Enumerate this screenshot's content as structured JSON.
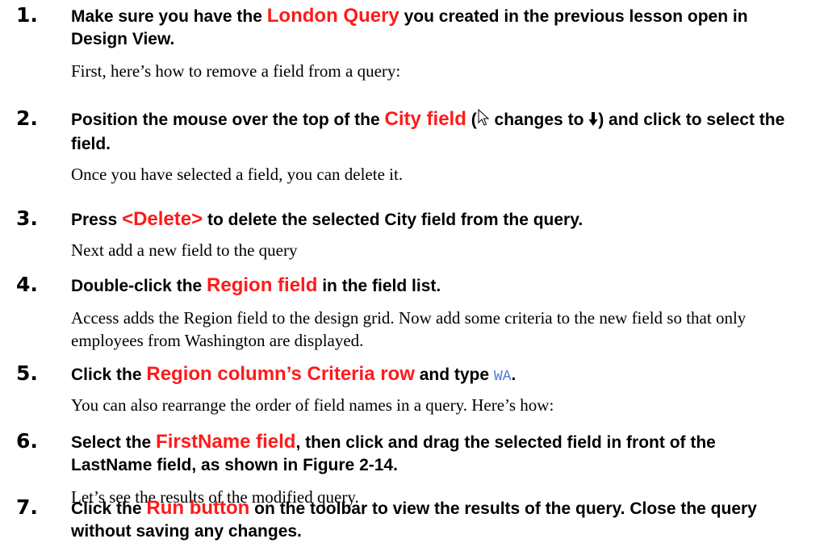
{
  "steps": [
    {
      "number": "1.",
      "parts": [
        "Make sure you have the ",
        "London Query",
        " you created in the previous lesson open in Design View."
      ],
      "note": "First, here’s how to remove a field from a query:"
    },
    {
      "number": "2.",
      "parts": [
        "Position the mouse over the top of the ",
        "City field",
        " (",
        " changes to ",
        ") and click to select the field."
      ],
      "icons": [
        "pointer-arrow-icon",
        "down-arrow-icon"
      ],
      "note": "Once you have selected a field, you can delete it."
    },
    {
      "number": "3.",
      "parts": [
        "Press ",
        "<Delete>",
        " to delete the selected City field from the query."
      ],
      "note": "Next add a new field to the query"
    },
    {
      "number": "4.",
      "parts": [
        "Double-click the ",
        "Region field",
        " in the field list."
      ],
      "note": "Access adds the Region field to the design grid. Now add some criteria to the new field so that only employees from Washington are displayed."
    },
    {
      "number": "5.",
      "parts": [
        "Click the ",
        "Region column’s Criteria row",
        " and type ",
        "WA",
        "."
      ],
      "note": "You can also rearrange the order of field names in a query. Here’s how:"
    },
    {
      "number": "6.",
      "parts": [
        "Select the ",
        "FirstName field",
        ", then click and drag the selected field in front of the LastName field, as shown in Figure 2-14."
      ],
      "note": "Let’s see the results of the modified query."
    },
    {
      "number": "7.",
      "parts": [
        "Click the ",
        "Run button",
        " on the toolbar to view the results of the query. Close the query without saving any changes."
      ]
    }
  ],
  "colors": {
    "highlight": "#ff1a1a",
    "code": "#4a7be0"
  }
}
